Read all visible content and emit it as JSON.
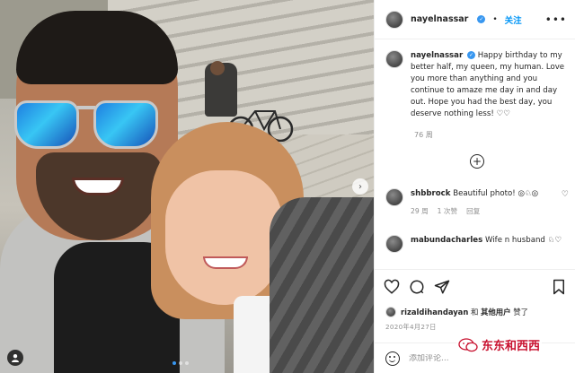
{
  "post": {
    "username": "nayelnassar",
    "follow_label": "关注",
    "separator": "•",
    "caption_text": "Happy birthday to my better half, my queen, my human. Love you more than anything and you continue to amaze me day in and day out. Hope you had the best day, you deserve nothing less! ♡♡",
    "caption_time": "76 周",
    "more_icon": "more-horizontal-icon",
    "date": "2020年4月27日"
  },
  "comments": [
    {
      "username": "shbbrock",
      "text": "Beautiful photo! ◎♘◎",
      "time": "29 周",
      "likes": "1 次赞",
      "reply": "回复"
    },
    {
      "username": "mabundacharles",
      "text": "Wife n husband ♘♡"
    }
  ],
  "likes": {
    "user": "rizaldihandayan",
    "connector": "和",
    "others": "其他用户",
    "suffix": "赞了"
  },
  "comment_box": {
    "placeholder": "添加评论..."
  },
  "watermark": {
    "text": "东东和西西"
  },
  "colors": {
    "accent": "#0095f6",
    "verified": "#3897f0",
    "watermark": "#c8102e",
    "muted": "#8e8e8e"
  }
}
